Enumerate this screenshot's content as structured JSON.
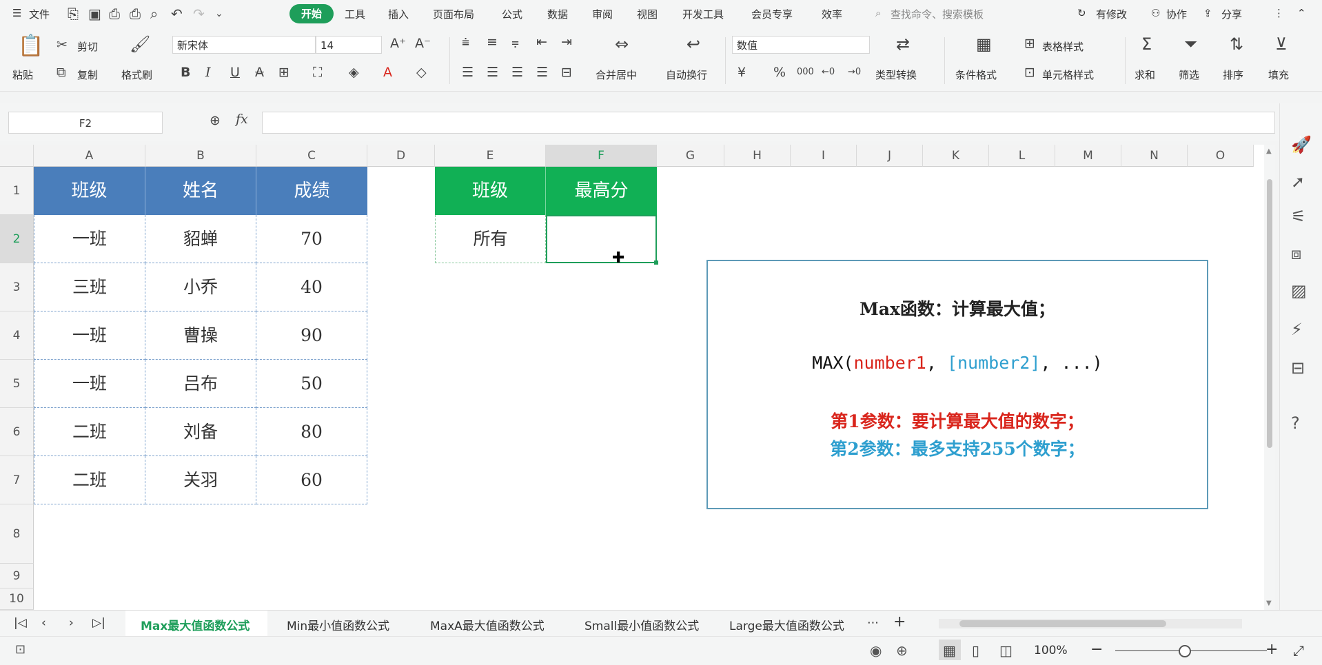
{
  "menubar": {
    "file": "文件",
    "tabs": [
      "开始",
      "工具",
      "插入",
      "页面布局",
      "公式",
      "数据",
      "审阅",
      "视图",
      "开发工具",
      "会员专享",
      "效率"
    ],
    "search_placeholder": "查找命令、搜索模板",
    "modified": "有修改",
    "collaborate": "协作",
    "share": "分享"
  },
  "ribbon": {
    "paste": "粘贴",
    "cut": "剪切",
    "copy": "复制",
    "format_painter": "格式刷",
    "font_name": "新宋体",
    "font_size": "14",
    "merge_center": "合并居中",
    "wrap_text": "自动换行",
    "number_format": "数值",
    "type_convert": "类型转换",
    "conditional_format": "条件格式",
    "table_style": "表格样式",
    "cell_style": "单元格样式",
    "sum": "求和",
    "filter": "筛选",
    "sort": "排序",
    "fill": "填充"
  },
  "formula_bar": {
    "name_box": "F2",
    "fx": "fx",
    "formula": ""
  },
  "columns": [
    "A",
    "B",
    "C",
    "D",
    "E",
    "F",
    "G",
    "H",
    "I",
    "J",
    "K",
    "L",
    "M",
    "N",
    "O"
  ],
  "rows": [
    "1",
    "2",
    "3",
    "4",
    "5",
    "6",
    "7",
    "8",
    "9",
    "10"
  ],
  "table1": {
    "headers": [
      "班级",
      "姓名",
      "成绩"
    ],
    "rows": [
      [
        "一班",
        "貂蝉",
        "70"
      ],
      [
        "三班",
        "小乔",
        "40"
      ],
      [
        "一班",
        "曹操",
        "90"
      ],
      [
        "一班",
        "吕布",
        "50"
      ],
      [
        "二班",
        "刘备",
        "80"
      ],
      [
        "二班",
        "关羽",
        "60"
      ]
    ]
  },
  "table2": {
    "headers": [
      "班级",
      "最高分"
    ],
    "row": [
      "所有",
      ""
    ]
  },
  "info": {
    "line1": "Max函数：计算最大值；",
    "line2_prefix": "MAX(",
    "line2_param1": "number1",
    "line2_sep": ", ",
    "line2_param2": "[number2]",
    "line2_suffix": ", ...)",
    "line3": "第1参数：要计算最大值的数字；",
    "line4": "第2参数：最多支持255个数字；"
  },
  "sheets": [
    "Max最大值函数公式",
    "Min最小值函数公式",
    "MaxA最大值函数公式",
    "Small最小值函数公式",
    "Large最大值函数公式"
  ],
  "status": {
    "zoom": "100%"
  },
  "colors": {
    "accent": "#1e9e5a",
    "blue_header": "#4a7ebb",
    "green_header": "#11b055",
    "red": "#d9251c",
    "cyan": "#2e9fcf"
  }
}
